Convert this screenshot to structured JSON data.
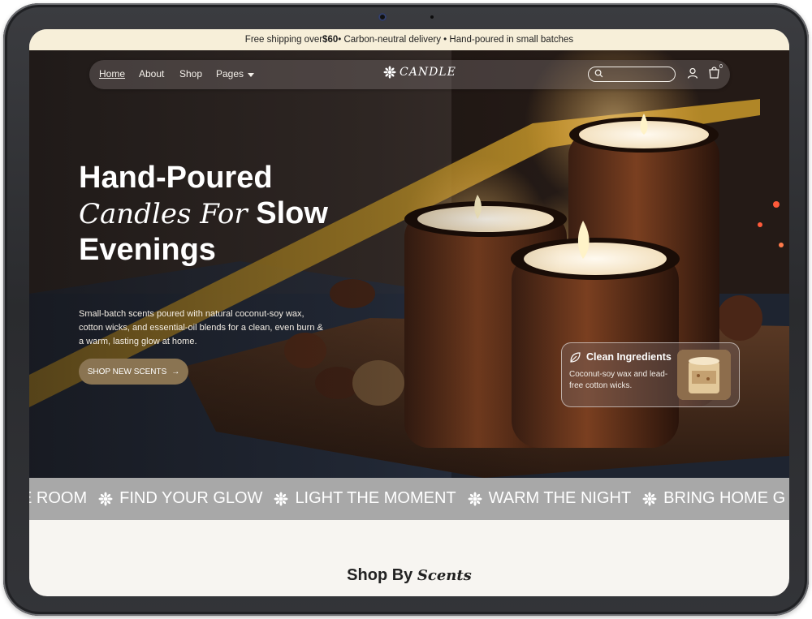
{
  "announcement": {
    "prefix": "Free shipping over ",
    "amount": "$60",
    "suffix": " • Carbon-neutral delivery • Hand-poured in small batches"
  },
  "nav": {
    "links": [
      "Home",
      "About",
      "Shop",
      "Pages"
    ],
    "active": "Home",
    "logo": "CANDLE",
    "search_placeholder": "",
    "cart_count": "0"
  },
  "hero": {
    "line1": "Hand-Poured",
    "line2_script": "Candles For",
    "line2_bold": "Slow",
    "line3": "Evenings",
    "description": "Small-batch scents poured with natural coconut-soy wax, cotton wicks, and essential-oil blends for a clean, even burn & a warm, lasting glow at home.",
    "cta_label": "SHOP NEW SCENTS",
    "cta_arrow": "→"
  },
  "ingredients_card": {
    "title": "Clean Ingredients",
    "description": "Coconut-soy wax and lead-free cotton wicks."
  },
  "marquee": {
    "items": [
      "E ROOM",
      "FIND YOUR GLOW",
      "LIGHT THE MOMENT",
      "WARM THE NIGHT",
      "BRING HOME G"
    ]
  },
  "section": {
    "title_plain": "Shop By",
    "title_script": "Scents"
  },
  "colors": {
    "announcement_bg": "#f7efd9",
    "cta_bg": "#8a7452",
    "marquee_bg": "#a8a8a8",
    "page_bg": "#f7f5f1"
  }
}
